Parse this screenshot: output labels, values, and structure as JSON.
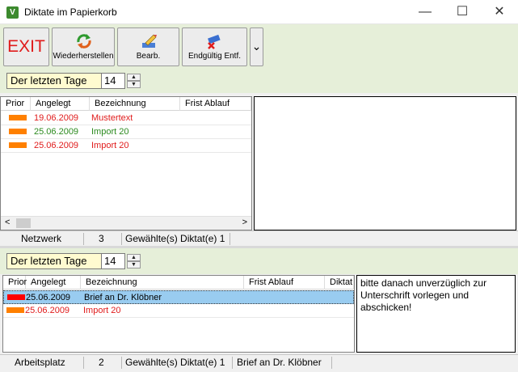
{
  "window": {
    "title": "Diktate im Papierkorb",
    "minimize_glyph": "—",
    "maximize_glyph": "☐",
    "close_glyph": "✕",
    "app_icon": "V"
  },
  "toolbar": {
    "exit_label": "EXIT",
    "restore_label": "Wiederherstellen",
    "edit_label": "Bearb.",
    "delete_label": "Endgültig Entf.",
    "more_glyph": "⌄"
  },
  "top": {
    "filter_label": "Der letzten Tage",
    "days": "14",
    "columns": [
      "Prior",
      "Angelegt",
      "Bezeichnung",
      "Frist Ablauf"
    ],
    "rows": [
      {
        "date": "19.06.2009",
        "name": "Mustertext",
        "deadline": "",
        "prio_color": "#ff8000",
        "text_color": "#e01b1b"
      },
      {
        "date": "25.06.2009",
        "name": "Import 20",
        "deadline": "",
        "prio_color": "#ff8000",
        "text_color": "#2b8a1e"
      },
      {
        "date": "25.06.2009",
        "name": "Import 20",
        "deadline": "",
        "prio_color": "#ff8000",
        "text_color": "#e01b1b"
      }
    ],
    "note": "",
    "status": {
      "location": "Netzwerk",
      "count": "3",
      "selected": "Gewählte(s) Diktat(e) 1"
    }
  },
  "bottom": {
    "filter_label": "Der letzten Tage",
    "days": "14",
    "columns": [
      "Prior",
      "Angelegt",
      "Bezeichnung",
      "Frist Ablauf",
      "Diktat"
    ],
    "rows": [
      {
        "date": "25.06.2009",
        "name": "Brief an Dr. Klöbner",
        "deadline": "",
        "prio_color": "#ff0000",
        "text_color": "#000000",
        "selected": true
      },
      {
        "date": "25.06.2009",
        "name": "Import 20",
        "deadline": "",
        "prio_color": "#ff8000",
        "text_color": "#e01b1b",
        "selected": false
      }
    ],
    "note": "bitte danach unverzüglich zur Unterschrift vorlegen und abschicken!",
    "status": {
      "location": "Arbeitsplatz",
      "count": "2",
      "selected": "Gewählte(s) Diktat(e) 1",
      "current": "Brief an Dr. Klöbner"
    }
  },
  "scroll": {
    "left_glyph": "<",
    "right_glyph": ">",
    "up_glyph": "▲",
    "down_glyph": "▼"
  }
}
